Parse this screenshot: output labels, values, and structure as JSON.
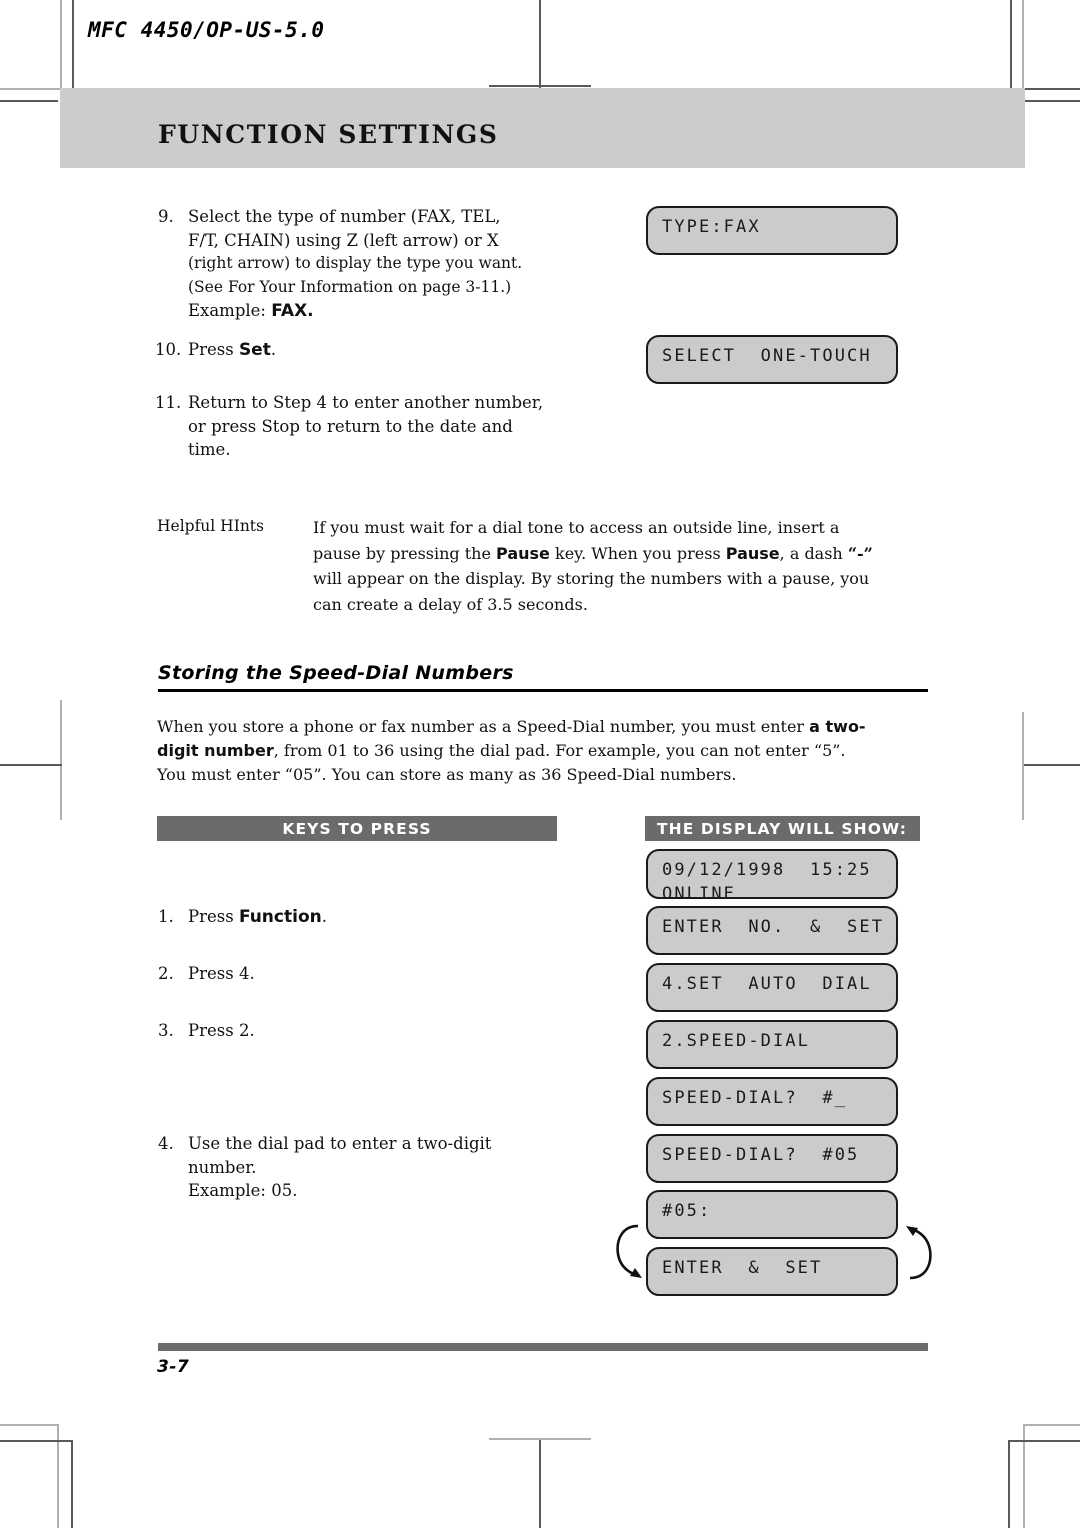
{
  "header": {
    "model": "MFC 4450/OP-US-5.0",
    "chapter_title": "FUNCTION SETTINGS"
  },
  "steps_top": [
    {
      "number": "9.",
      "lines": [
        "Select the type of number (FAX, TEL,",
        "F/T, CHAIN) using Z (left arrow) or X",
        "(right arrow) to display the type you want.",
        "(See For Your Information on page 3-11.)"
      ],
      "example_label": "Example: ",
      "example_value": "FAX."
    },
    {
      "number": "10.",
      "prefix": "Press ",
      "key": "Set",
      "suffix": "."
    },
    {
      "number": "11.",
      "lines": [
        "Return to Step 4 to enter another number,",
        "or press Stop to return to the date and",
        "time."
      ]
    }
  ],
  "displays_top": [
    {
      "line1": "TYPE:FAX",
      "line2": ""
    },
    {
      "line1": "SELECT  ONE-TOUCH",
      "line2": ""
    }
  ],
  "hints": {
    "label": "Helpful HInts",
    "line1_a": "If you must wait for a dial tone to access an outside line, insert a",
    "line2_a": "pause by pressing the ",
    "line2_b": "Pause",
    "line2_c": " key. When you press ",
    "line2_d": "Pause",
    "line2_e": ", a dash ",
    "line2_f": "“-”",
    "line3_a": "will appear on the display. By storing the numbers with a pause, you",
    "line4_a": "can create a delay of 3.5 seconds."
  },
  "section": {
    "heading": "Storing the Speed-Dial Numbers",
    "body_l1_a": "When you store a phone or fax number as a Speed-Dial number, you must enter ",
    "body_l1_b": "a two-",
    "body_l2_a": "digit number",
    "body_l2_b": ",  from 01 to 36 using the dial pad. For example, you can not enter “5”.",
    "body_l3": "You must enter “05”. You can store as many as 36 Speed-Dial numbers."
  },
  "table": {
    "header_keys": "KEYS TO PRESS",
    "header_display": "THE DISPLAY WILL SHOW:"
  },
  "steps_bottom": [
    {
      "number": "1.",
      "prefix": "Press ",
      "key": "Function",
      "suffix": "."
    },
    {
      "number": "2.",
      "prefix": "Press ",
      "key": "4",
      "suffix": ".",
      "key_bold": false
    },
    {
      "number": "3.",
      "prefix": "Press ",
      "key": "2",
      "suffix": ".",
      "key_bold": false
    },
    {
      "number": "4.",
      "lines": [
        "Use the dial pad to enter a two-digit",
        "number.",
        "Example: 05."
      ]
    }
  ],
  "displays_bottom": [
    {
      "line1": "09/12/1998  15:25",
      "line2": "ONLINE"
    },
    {
      "line1": "ENTER  NO.  &  SET",
      "line2": ""
    },
    {
      "line1": "4.SET  AUTO  DIAL",
      "line2": ""
    },
    {
      "line1": "2.SPEED-DIAL",
      "line2": ""
    },
    {
      "line1": "SPEED-DIAL?  #_",
      "line2": ""
    },
    {
      "line1": "SPEED-DIAL?  #05",
      "line2": ""
    },
    {
      "line1": "#05:",
      "line2": ""
    },
    {
      "line1": "ENTER  &  SET",
      "line2": ""
    }
  ],
  "footer": {
    "page_number": "3-7"
  },
  "colors": {
    "title_band": "#cccccc",
    "bar": "#6b6b6b",
    "lcd_fill": "#cbcbcb",
    "lcd_border": "#1a1a1a",
    "crop_mark": "#8a8a8a"
  }
}
